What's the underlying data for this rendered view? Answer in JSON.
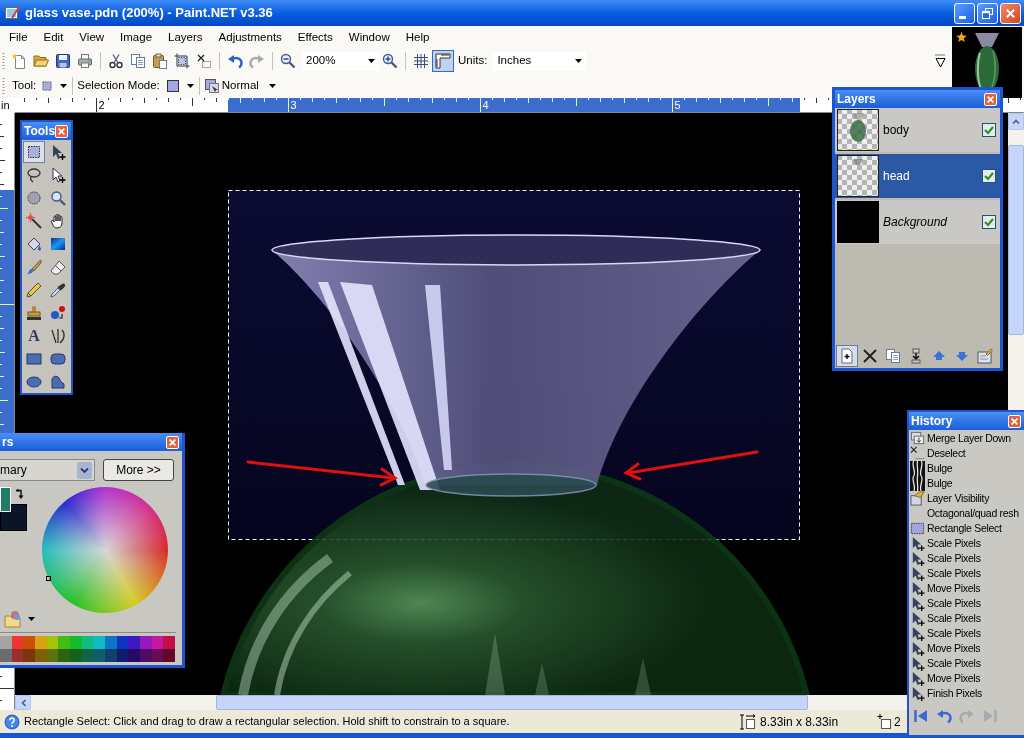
{
  "window": {
    "title": "glass vase.pdn (200%) - Paint.NET v3.36"
  },
  "menu": [
    "File",
    "Edit",
    "View",
    "Image",
    "Layers",
    "Adjustments",
    "Effects",
    "Window",
    "Help"
  ],
  "toolbar": {
    "undo": {
      "disabled": false
    },
    "redo": {
      "disabled": true
    },
    "zoom": "200%",
    "grid": {
      "on": false
    },
    "rulers": {
      "on": true
    },
    "units_label": "Units:",
    "units": "Inches"
  },
  "tool_options": {
    "tool_label": "Tool:",
    "selection_mode_label": "Selection Mode:",
    "blend_mode": "Normal"
  },
  "ruler": {
    "unit": "in",
    "labels": [
      "2",
      "3",
      "4",
      "5"
    ]
  },
  "tools_window": {
    "title": "Tools",
    "tools": [
      {
        "selected": true
      },
      {
        "selected": false
      },
      {
        "selected": false
      },
      {
        "selected": false
      },
      {
        "selected": false
      },
      {
        "selected": false
      },
      {
        "selected": false
      },
      {
        "selected": false
      },
      {
        "selected": false
      },
      {
        "selected": false
      },
      {
        "selected": false
      },
      {
        "selected": false
      },
      {
        "selected": false
      },
      {
        "selected": false
      },
      {
        "selected": false
      },
      {
        "selected": false
      },
      {
        "selected": false,
        "glyph": "A"
      },
      {
        "selected": false
      },
      {
        "selected": false
      },
      {
        "selected": false
      },
      {
        "selected": false
      },
      {
        "selected": false
      }
    ]
  },
  "layers_window": {
    "title": "Layers",
    "layers": [
      {
        "name": "body",
        "kind": "layer",
        "selected": false,
        "visible": true
      },
      {
        "name": "head",
        "kind": "layer",
        "selected": true,
        "visible": true
      },
      {
        "name": "Background",
        "kind": "background",
        "selected": false,
        "visible": true
      }
    ]
  },
  "colors_window": {
    "title": "rs",
    "mode": "mary",
    "more_button": "More >>",
    "primary": {
      "color": "#1f7d66"
    },
    "secondary": {
      "color": "#0b1527"
    },
    "palette": [
      {
        "color": "#a4a4a4"
      },
      {
        "color": "#f03434"
      },
      {
        "color": "#c85008"
      },
      {
        "color": "#dca010"
      },
      {
        "color": "#a4c40c"
      },
      {
        "color": "#44bc14"
      },
      {
        "color": "#14bc2c"
      },
      {
        "color": "#10bc80"
      },
      {
        "color": "#10bcc4"
      },
      {
        "color": "#1074c4"
      },
      {
        "color": "#1034c0"
      },
      {
        "color": "#3c18c0"
      },
      {
        "color": "#9818c0"
      },
      {
        "color": "#c418a4"
      },
      {
        "color": "#c41048"
      },
      {
        "color": "#6c6c6c"
      },
      {
        "color": "#983030"
      },
      {
        "color": "#7c3408"
      },
      {
        "color": "#7c6008"
      },
      {
        "color": "#607010"
      },
      {
        "color": "#2c6414"
      },
      {
        "color": "#10641c"
      },
      {
        "color": "#106448"
      },
      {
        "color": "#105c6c"
      },
      {
        "color": "#10406c"
      },
      {
        "color": "#101c6c"
      },
      {
        "color": "#240c64"
      },
      {
        "color": "#500c64"
      },
      {
        "color": "#640c54"
      },
      {
        "color": "#640828"
      }
    ]
  },
  "history_window": {
    "title": "History",
    "items": [
      {
        "label": "Merge Layer Down",
        "kind": "merge"
      },
      {
        "label": "Deselect",
        "kind": "deselect"
      },
      {
        "label": "Bulge",
        "kind": "bulge"
      },
      {
        "label": "Bulge",
        "kind": "bulge"
      },
      {
        "label": "Layer Visibility",
        "kind": "layer"
      },
      {
        "label": "Octagonal/quad resh",
        "kind": "plugin"
      },
      {
        "label": "Rectangle Select",
        "kind": "select"
      },
      {
        "label": "Scale Pixels",
        "kind": "move"
      },
      {
        "label": "Scale Pixels",
        "kind": "move"
      },
      {
        "label": "Scale Pixels",
        "kind": "move"
      },
      {
        "label": "Move Pixels",
        "kind": "move"
      },
      {
        "label": "Scale Pixels",
        "kind": "move"
      },
      {
        "label": "Scale Pixels",
        "kind": "move"
      },
      {
        "label": "Scale Pixels",
        "kind": "move"
      },
      {
        "label": "Move Pixels",
        "kind": "move"
      },
      {
        "label": "Scale Pixels",
        "kind": "move"
      },
      {
        "label": "Move Pixels",
        "kind": "move"
      },
      {
        "label": "Finish Pixels",
        "kind": "move"
      }
    ],
    "controls": [
      {
        "disabled": false
      },
      {
        "disabled": false
      },
      {
        "disabled": true
      },
      {
        "disabled": true
      }
    ]
  },
  "status_bar": {
    "hint": "Rectangle Select: Click and drag to draw a rectangular selection. Hold shift to constrain to a square.",
    "size": "8.33in x 8.33in",
    "cursor": "2"
  }
}
